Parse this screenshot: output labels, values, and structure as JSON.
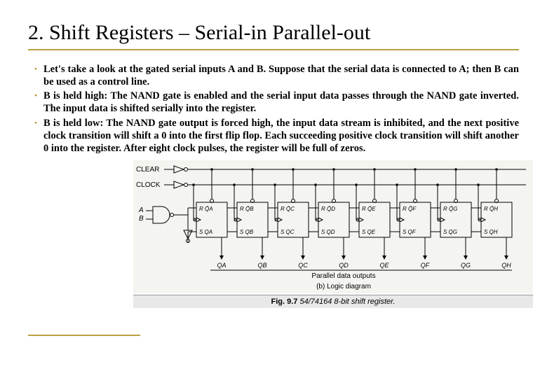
{
  "title": "2. Shift Registers – Serial-in Parallel-out",
  "bullets": [
    {
      "lead": "",
      "text": "Let's take a look at the gated serial inputs A and B. Suppose that the serial data is connected to A; then B can be used as a control line."
    },
    {
      "lead": "B is held high:",
      "text": " The NAND gate is enabled and the serial input data passes through the NAND gate inverted. The input data is shifted serially into the register."
    },
    {
      "lead": "B is held low:",
      "text": " The NAND gate output is forced high, the input data stream is inhibited, and the next positive clock transition will shift a 0 into the first flip flop.  Each succeeding positive clock transition will shift another 0 into the register. After eight clock pulses, the register will be full of zeros."
    }
  ],
  "diagram": {
    "input_clear": "CLEAR",
    "input_clock": "CLOCK",
    "input_a": "A",
    "input_b": "B",
    "ff_labels_top": [
      "R  Q̄A",
      "R  Q̄B",
      "R  Q̄C",
      "R  Q̄D",
      "R  Q̄E",
      "R  Q̄F",
      "R  Q̄G",
      "R  Q̄H"
    ],
    "ff_labels_bot": [
      "S  QA",
      "S  QB",
      "S  QC",
      "S  QD",
      "S  QE",
      "S  QF",
      "S  QG",
      "S  QH"
    ],
    "outputs": [
      "QA",
      "QB",
      "QC",
      "QD",
      "QE",
      "QF",
      "QG",
      "QH"
    ],
    "parallel_label": "Parallel data outputs",
    "subcaption": "(b) Logic diagram",
    "fig_caption_bold": "Fig. 9.7",
    "fig_caption_rest": "  54/74164 8-bit shift register."
  }
}
